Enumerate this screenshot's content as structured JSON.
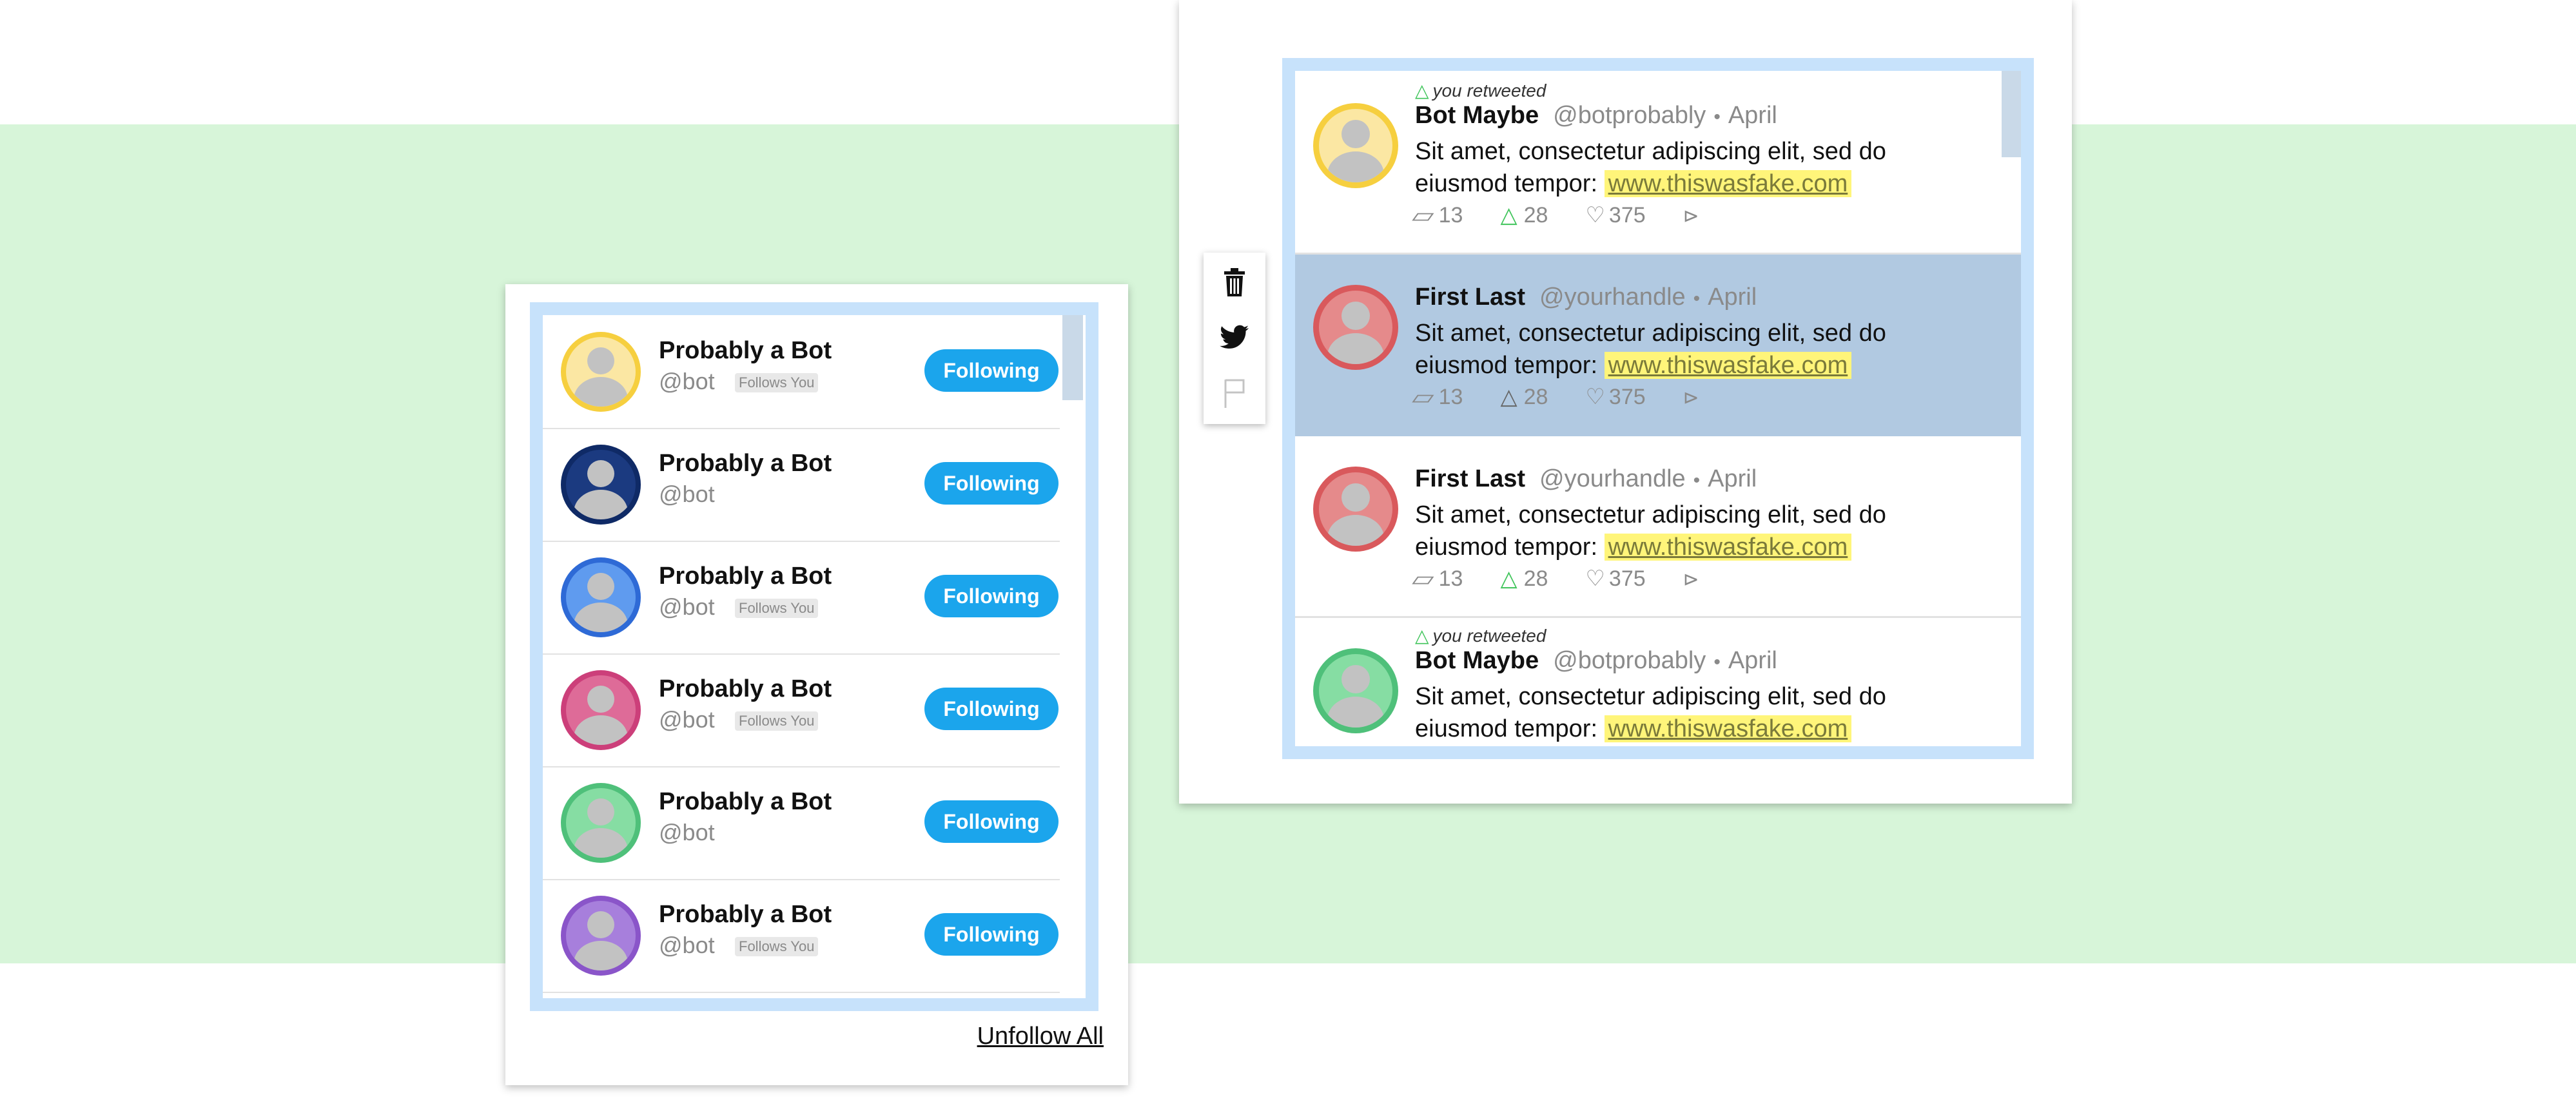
{
  "follow_list": {
    "rows": [
      {
        "name": "Probably a Bot",
        "handle": "@bot",
        "badge": "Follows You",
        "button": "Following",
        "avatar_color": "#f6cf3f",
        "avatar_bg": "#fbe7a3"
      },
      {
        "name": "Probably a Bot",
        "handle": "@bot",
        "badge": "",
        "button": "Following",
        "avatar_color": "#0f2a66",
        "avatar_bg": "#1b3a80"
      },
      {
        "name": "Probably a Bot",
        "handle": "@bot",
        "badge": "Follows You",
        "button": "Following",
        "avatar_color": "#2e6ad6",
        "avatar_bg": "#5f9bef"
      },
      {
        "name": "Probably a Bot",
        "handle": "@bot",
        "badge": "Follows You",
        "button": "Following",
        "avatar_color": "#cc3f7a",
        "avatar_bg": "#de6b98"
      },
      {
        "name": "Probably a Bot",
        "handle": "@bot",
        "badge": "",
        "button": "Following",
        "avatar_color": "#4fc07a",
        "avatar_bg": "#86dda3"
      },
      {
        "name": "Probably a Bot",
        "handle": "@bot",
        "badge": "Follows You",
        "button": "Following",
        "avatar_color": "#8a55c9",
        "avatar_bg": "#a77fdc"
      }
    ],
    "unfollow_all": "Unfollow All"
  },
  "timeline": {
    "tweets": [
      {
        "retweet_note": "you retweeted",
        "name": "Bot Maybe",
        "handle": "@botprobably",
        "date": "April",
        "text": "Sit amet, consectetur adipiscing elit, sed do eiusmod tempor:",
        "link": "www.thiswasfake.com",
        "replies": "13",
        "retweets": "28",
        "likes": "375",
        "retweet_active": true,
        "avatar_color": "#f6cf3f",
        "avatar_bg": "#fbe7a3",
        "highlighted": false
      },
      {
        "retweet_note": "",
        "name": "First Last",
        "handle": "@yourhandle",
        "date": "April",
        "text": "Sit amet, consectetur adipiscing elit, sed do eiusmod tempor:",
        "link": "www.thiswasfake.com",
        "replies": "13",
        "retweets": "28",
        "likes": "375",
        "retweet_active": false,
        "avatar_color": "#d9595c",
        "avatar_bg": "#e58a8b",
        "highlighted": true
      },
      {
        "retweet_note": "",
        "name": "First Last",
        "handle": "@yourhandle",
        "date": "April",
        "text": "Sit amet, consectetur adipiscing elit, sed do eiusmod tempor:",
        "link": "www.thiswasfake.com",
        "replies": "13",
        "retweets": "28",
        "likes": "375",
        "retweet_active": true,
        "avatar_color": "#d9595c",
        "avatar_bg": "#e58a8b",
        "highlighted": false
      },
      {
        "retweet_note": "you retweeted",
        "name": "Bot Maybe",
        "handle": "@botprobably",
        "date": "April",
        "text": "Sit amet, consectetur adipiscing elit, sed do eiusmod tempor:",
        "link": "www.thiswasfake.com",
        "replies": "",
        "retweets": "",
        "likes": "",
        "retweet_active": true,
        "avatar_color": "#4fc07a",
        "avatar_bg": "#86dda3",
        "highlighted": false
      }
    ],
    "tools": [
      {
        "icon": "trash-icon"
      },
      {
        "icon": "twitter-bird-icon"
      },
      {
        "icon": "flag-icon"
      }
    ]
  },
  "colors": {
    "band": "#d7f5d9",
    "frame": "#c7e2fb",
    "following_button": "#1ba5ec",
    "highlight_row": "#b1c9e1",
    "link_highlight": "#fff57a"
  }
}
